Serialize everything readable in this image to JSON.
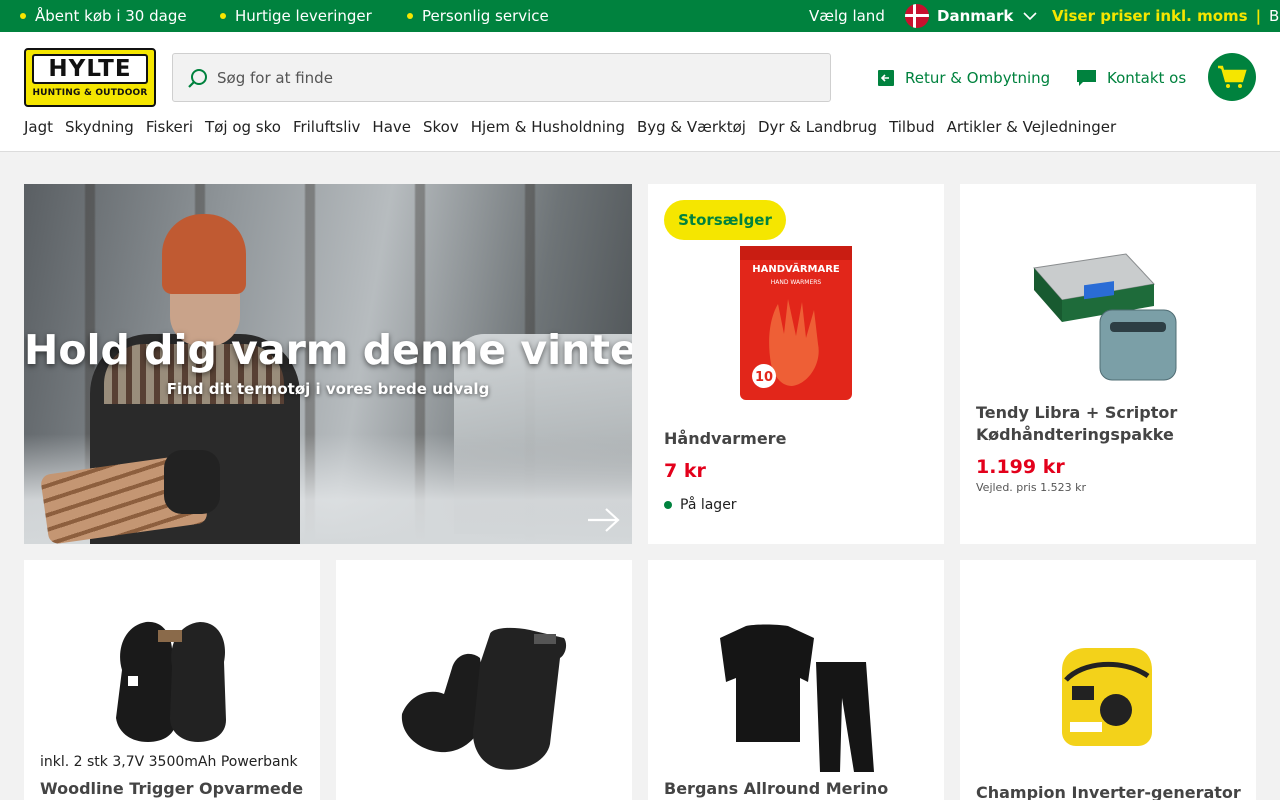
{
  "topbar": {
    "usps": [
      "Åbent køb i 30 dage",
      "Hurtige leveringer",
      "Personlig service"
    ],
    "choose_country": "Vælg land",
    "country": "Danmark",
    "price_mode": "Viser priser inkl. moms",
    "separator": "|",
    "switch": "Byt",
    "colors": {
      "bar": "#00823e",
      "accent": "#f5e600"
    }
  },
  "header": {
    "logo_text": "HYLTE",
    "logo_sub": "HUNTING & OUTDOOR",
    "search_placeholder": "Søg for at finde",
    "return_link": "Retur & Ombytning",
    "contact_link": "Kontakt os",
    "nav": [
      "Jagt",
      "Skydning",
      "Fiskeri",
      "Tøj og sko",
      "Friluftsliv",
      "Have",
      "Skov",
      "Hjem & Husholdning",
      "Byg & Værktøj",
      "Dyr & Landbrug",
      "Tilbud",
      "Artikler & Vejledninger"
    ]
  },
  "hero": {
    "title": "Hold dig varm denne vinter",
    "subtitle": "Find dit termotøj i vores brede udvalg"
  },
  "products": [
    {
      "badge": "Storsælger",
      "image_text": "HANDVÄRMARE",
      "image_sub": "HAND WARMERS",
      "image_hours": "10",
      "name": "Håndvarmere",
      "price": "7 kr",
      "stock": "På lager"
    },
    {
      "name_line1": "Tendy Libra + Scriptor",
      "name_line2": "Kødhåndteringspakke",
      "price": "1.199 kr",
      "rrp": "Vejled. pris 1.523 kr"
    },
    {
      "note": "inkl. 2 stk 3,7V 3500mAh Powerbank",
      "name": "Woodline Trigger Opvarmede"
    },
    {
      "name": ""
    },
    {
      "name": "Bergans Allround Merino"
    },
    {
      "name": "Champion Inverter-generator"
    }
  ]
}
